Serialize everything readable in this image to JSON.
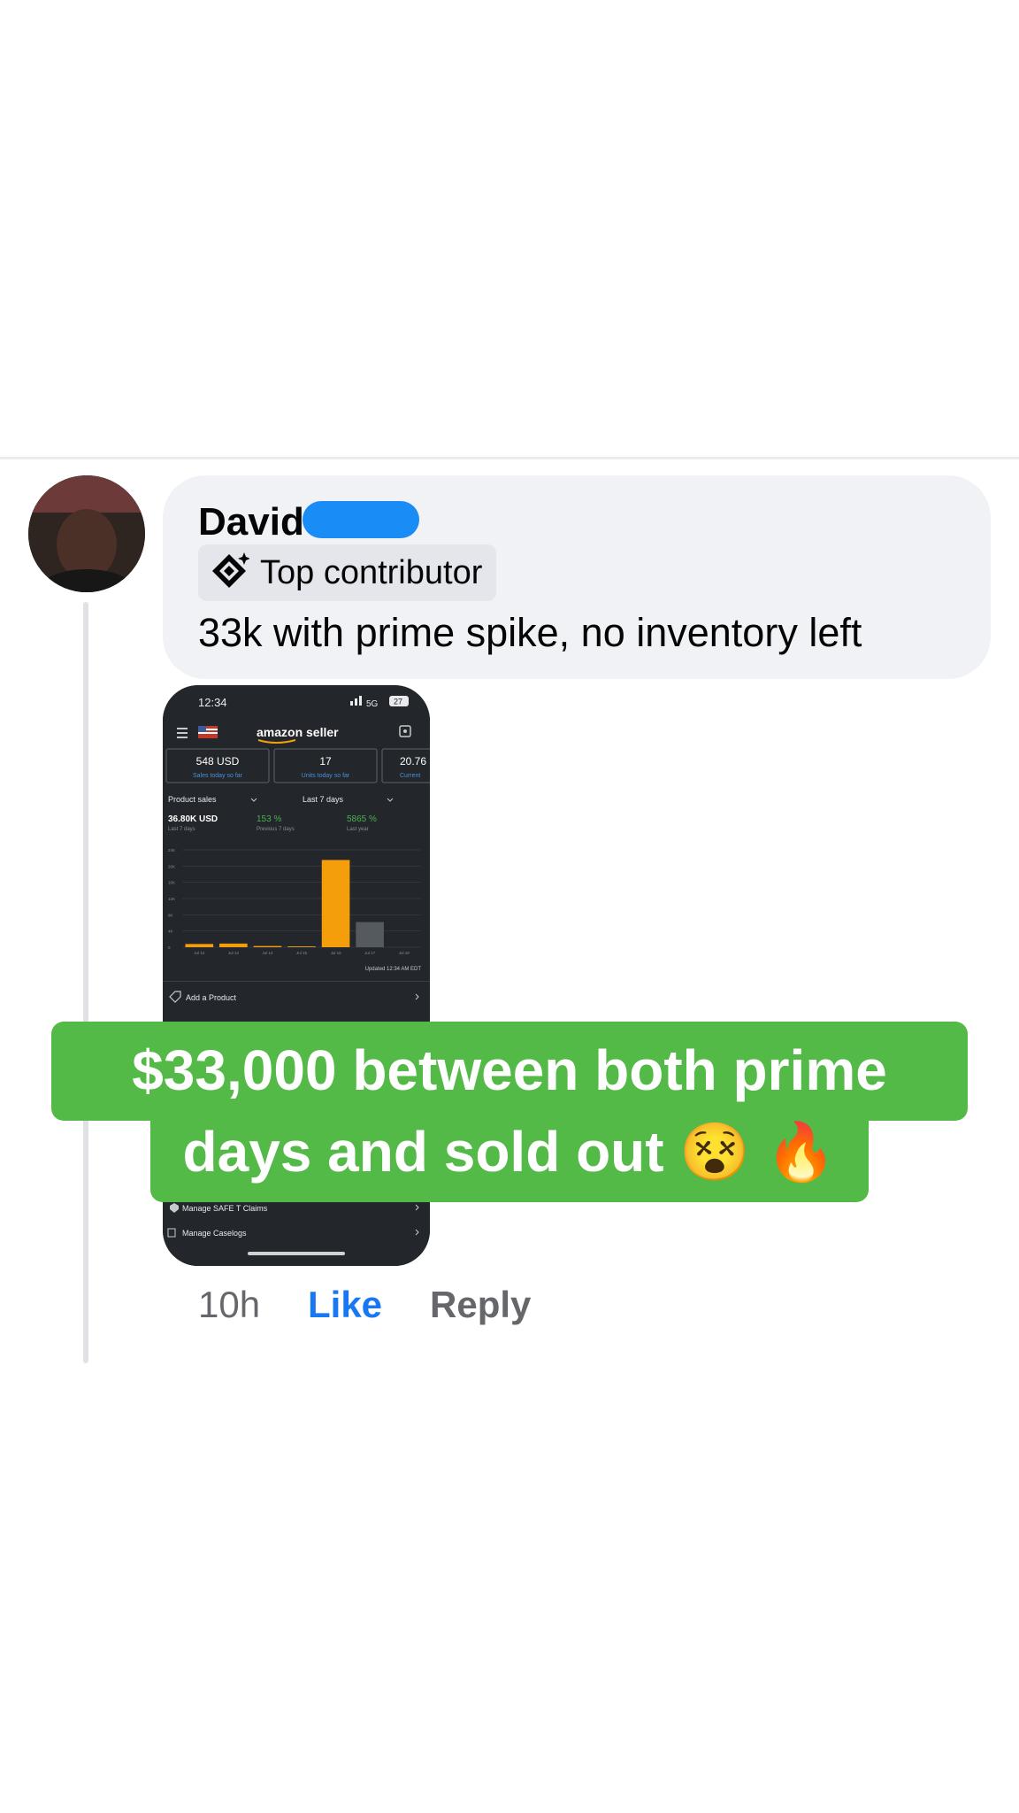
{
  "comment": {
    "author": "David",
    "badge_label": "Top contributor",
    "text": "33k with prime spike, no inventory left",
    "time": "10h",
    "like_label": "Like",
    "reply_label": "Reply"
  },
  "phone": {
    "status_time": "12:34",
    "network": "5G",
    "battery": "27",
    "app_title": "amazon seller",
    "cards": [
      {
        "value": "548 USD",
        "label": "Sales today so far"
      },
      {
        "value": "17",
        "label": "Units today so far"
      },
      {
        "value": "20.76",
        "label": "Current"
      }
    ],
    "sales_dropdown": "Product sales",
    "range_dropdown": "Last 7 days",
    "stats": [
      {
        "value": "36.80K USD",
        "label": "Last 7 days"
      },
      {
        "value": "153 %",
        "label": "Previous 7 days"
      },
      {
        "value": "5865 %",
        "label": "Last year"
      }
    ],
    "updated": "Updated 12:34 AM EDT",
    "menu": [
      "Add a Product",
      "Manage SAFE T Claims",
      "Manage Caselogs"
    ]
  },
  "chart_data": {
    "type": "bar",
    "categories": [
      "Jul 12",
      "Jul 13",
      "Jul 14",
      "Jul 15",
      "Jul 16",
      "Jul 17",
      "Jul 18"
    ],
    "series": [
      {
        "values": [
          800,
          900,
          300,
          200,
          21500,
          6200,
          0
        ],
        "colors": [
          "#f59e0b",
          "#f59e0b",
          "#f59e0b",
          "#f59e0b",
          "#f59e0b",
          "#555a60",
          "#555a60"
        ]
      }
    ],
    "ytick_labels": [
      "0",
      "4K",
      "8K",
      "12K",
      "16K",
      "20K",
      "24K"
    ],
    "ylim": [
      0,
      24000
    ]
  },
  "overlay": {
    "line1": "$33,000 between both prime",
    "line2": "days and sold out",
    "emoji1": "😵",
    "emoji2": "🔥"
  },
  "colors": {
    "like": "#1877f2",
    "overlay_green": "#53b947",
    "redaction": "#1a8cf5",
    "chart_orange": "#f59e0b"
  }
}
